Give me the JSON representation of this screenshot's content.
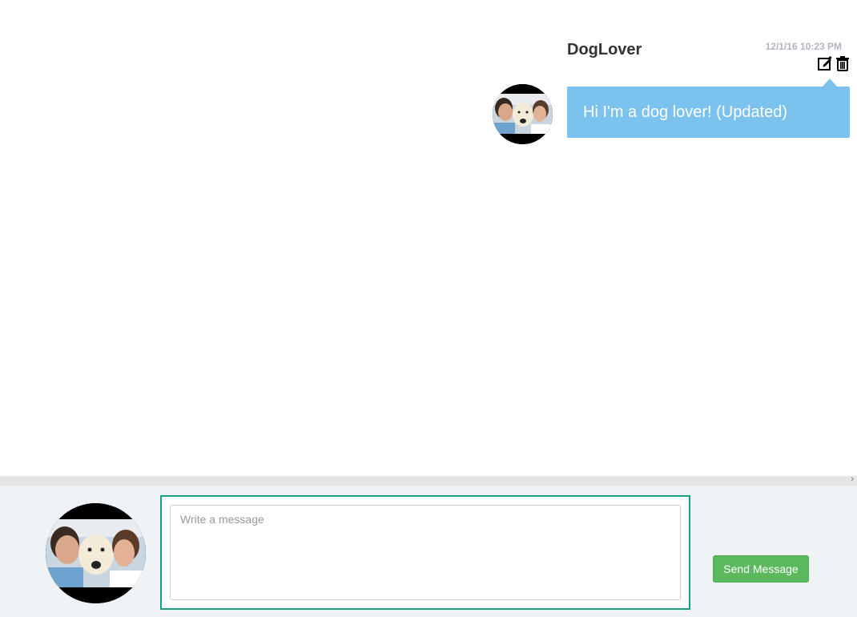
{
  "message": {
    "username": "DogLover",
    "timestamp": "12/1/16 10:23 PM",
    "text": "Hi I'm a dog lover! (Updated)",
    "actions": {
      "edit_icon": "edit-icon",
      "delete_icon": "trash-icon"
    },
    "bubble_color": "#7cc2ee"
  },
  "composer": {
    "placeholder": "Write a message",
    "value": "",
    "send_label": "Send Message",
    "frame_color": "#16a088",
    "send_color": "#5cb85c"
  },
  "scrollbar": {
    "arrow": "›"
  }
}
